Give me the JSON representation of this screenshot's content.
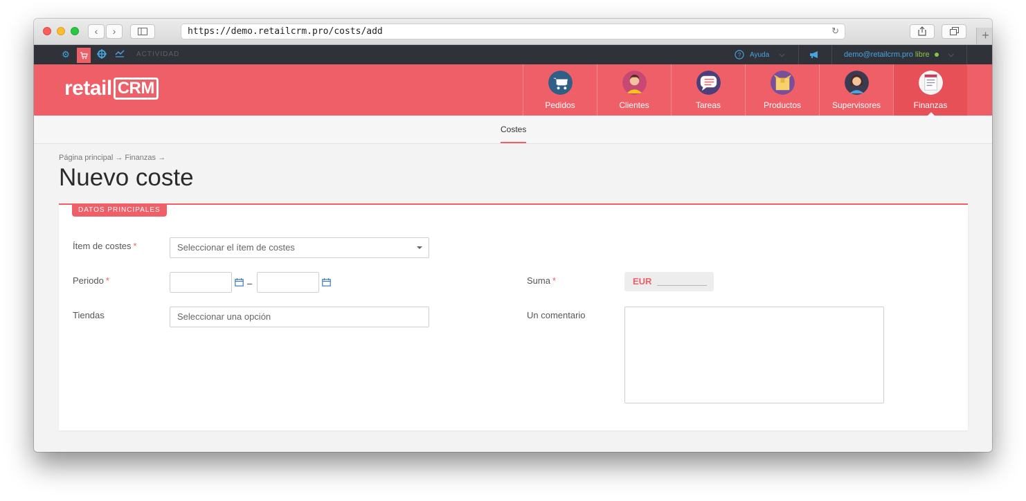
{
  "browser": {
    "url": "https://demo.retailcrm.pro/costs/add",
    "new_tab": "+"
  },
  "topbar": {
    "activity_label": "ACTIVIDAD",
    "help_label": "Ayuda",
    "user_email": "demo@retailcrm.pro",
    "user_status": "libre",
    "status_color": "#8bc34a"
  },
  "header": {
    "logo_text": "retail",
    "logo_crm": "CRM",
    "nav": [
      {
        "label": "Pedidos",
        "icon": "cart-icon",
        "color": "#2f5f86"
      },
      {
        "label": "Clientes",
        "icon": "customer-icon",
        "color": "#c74873"
      },
      {
        "label": "Tareas",
        "icon": "chat-bubble-icon",
        "color": "#4c3f7a"
      },
      {
        "label": "Productos",
        "icon": "box-icon",
        "color": "#7a4f9a"
      },
      {
        "label": "Supervisores",
        "icon": "manager-icon",
        "color": "#3a3b52"
      },
      {
        "label": "Finanzas",
        "icon": "document-icon",
        "color": "#f5f5f5"
      }
    ],
    "active_nav": "Finanzas"
  },
  "subnav": {
    "tab": "Costes"
  },
  "page": {
    "breadcrumb": "Página principal → Finanzas →",
    "title": "Nuevo coste",
    "section": "DATOS PRINCIPALES"
  },
  "form": {
    "cost_item_label": "Ítem de costes",
    "cost_item_placeholder": "Seleccionar el ítem de costes",
    "period_label": "Periodo",
    "period_dash": "–",
    "stores_label": "Tiendas",
    "stores_placeholder": "Seleccionar una opción",
    "amount_label": "Suma",
    "currency": "EUR",
    "comment_label": "Un comentario",
    "required_mark": "*"
  },
  "colors": {
    "brand_red": "#ef5f67",
    "dark_bar": "#2f3339",
    "link_blue": "#4aa3df"
  }
}
